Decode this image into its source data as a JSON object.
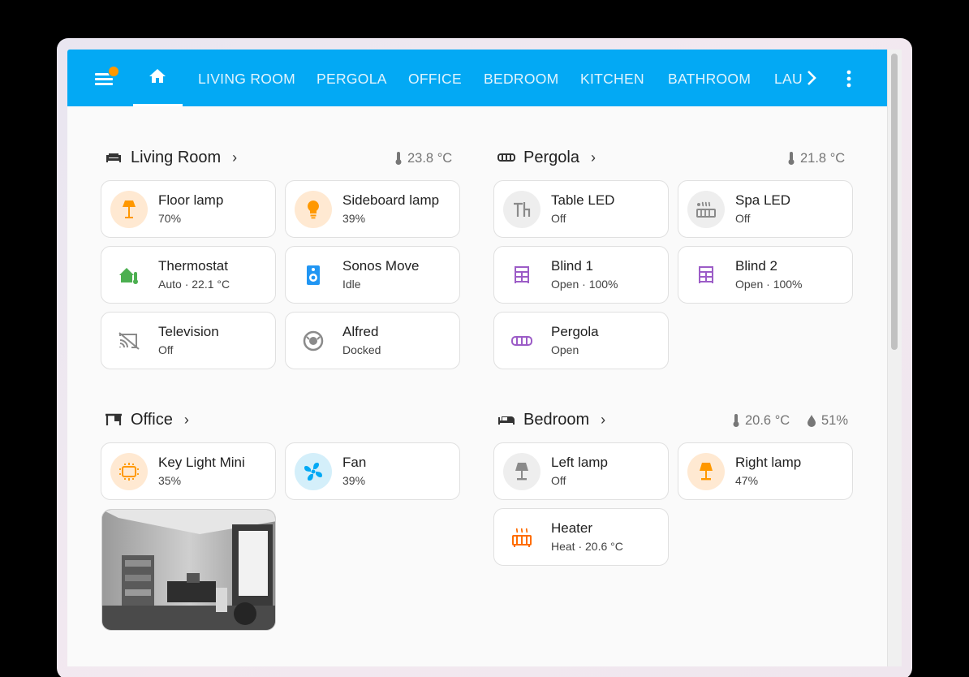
{
  "topbar": {
    "tabs": [
      {
        "label": "LIVING ROOM"
      },
      {
        "label": "PERGOLA"
      },
      {
        "label": "OFFICE"
      },
      {
        "label": "BEDROOM"
      },
      {
        "label": "KITCHEN"
      },
      {
        "label": "BATHROOM"
      },
      {
        "label": "LAU"
      }
    ],
    "accent": "#03a9f4",
    "notification_color": "#ff9800"
  },
  "areas": {
    "living_room": {
      "name": "Living Room",
      "temperature": "23.8 °C",
      "cards": [
        {
          "name": "Floor lamp",
          "state": "70%",
          "icon": "floor-lamp-icon"
        },
        {
          "name": "Sideboard lamp",
          "state": "39%",
          "icon": "bulb-icon"
        },
        {
          "name": "Thermostat",
          "state": "Auto · 22.1 °C",
          "icon": "home-thermometer-icon"
        },
        {
          "name": "Sonos Move",
          "state": "Idle",
          "icon": "speaker-icon"
        },
        {
          "name": "Television",
          "state": "Off",
          "icon": "cast-off-icon"
        },
        {
          "name": "Alfred",
          "state": "Docked",
          "icon": "robot-vacuum-icon"
        }
      ]
    },
    "pergola": {
      "name": "Pergola",
      "temperature": "21.8 °C",
      "cards": [
        {
          "name": "Table LED",
          "state": "Off",
          "icon": "table-chair-icon"
        },
        {
          "name": "Spa LED",
          "state": "Off",
          "icon": "hot-tub-icon"
        },
        {
          "name": "Blind 1",
          "state": "Open · 100%",
          "icon": "blinds-icon"
        },
        {
          "name": "Blind 2",
          "state": "Open · 100%",
          "icon": "blinds-icon"
        },
        {
          "name": "Pergola",
          "state": "Open",
          "icon": "awning-icon"
        }
      ]
    },
    "office": {
      "name": "Office",
      "cards": [
        {
          "name": "Key Light Mini",
          "state": "35%",
          "icon": "led-panel-icon"
        },
        {
          "name": "Fan",
          "state": "39%",
          "icon": "fan-icon"
        }
      ]
    },
    "bedroom": {
      "name": "Bedroom",
      "temperature": "20.6 °C",
      "humidity": "51%",
      "cards": [
        {
          "name": "Left lamp",
          "state": "Off",
          "icon": "lamp-icon"
        },
        {
          "name": "Right lamp",
          "state": "47%",
          "icon": "lamp-icon"
        },
        {
          "name": "Heater",
          "state": "Heat · 20.6 °C",
          "icon": "radiator-icon"
        }
      ]
    }
  },
  "colors": {
    "light_on": "#ff9800",
    "light_on_bg": "#ffe9d2",
    "climate_green": "#4caf50",
    "media_blue": "#2196f3",
    "cover_purple": "#9c5cc7",
    "off_grey": "#8a8a8a",
    "off_bg": "#eeeeee",
    "fan_cyan": "#03a9f4",
    "fan_bg": "#d4effa",
    "heater_orange": "#ff6d00"
  }
}
